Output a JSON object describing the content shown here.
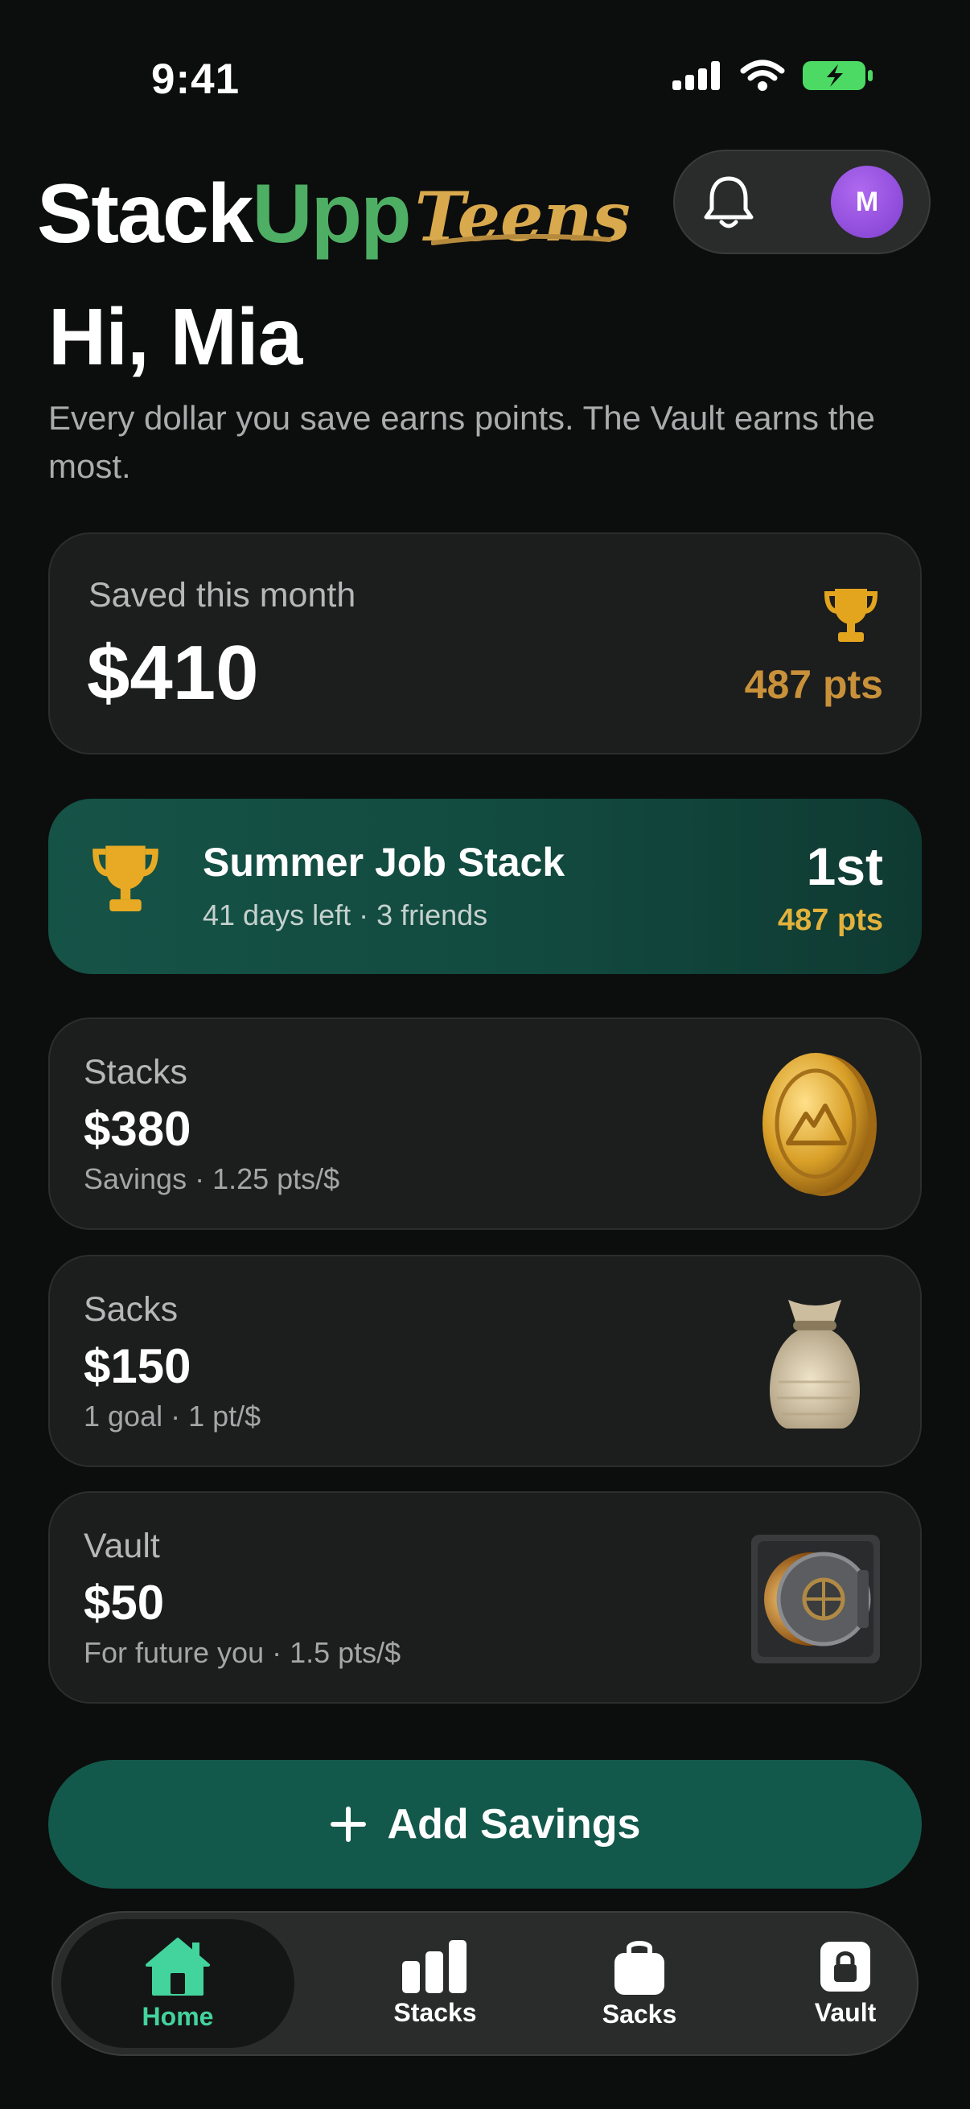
{
  "status_bar": {
    "time": "9:41"
  },
  "header": {
    "logo_stack": "Stack",
    "logo_upp": "Upp",
    "logo_teens": "Teens",
    "avatar_initial": "M"
  },
  "greeting": {
    "title": "Hi, Mia",
    "subtitle": "Every dollar you save earns points. The Vault earns the most."
  },
  "saved_card": {
    "label": "Saved this month",
    "amount": "$410",
    "points": "487 pts"
  },
  "challenge": {
    "title": "Summer Job Stack",
    "subtitle": "41 days left · 3 friends",
    "rank": "1st",
    "points": "487 pts"
  },
  "accounts": [
    {
      "label": "Stacks",
      "amount": "$380",
      "sub": "Savings · 1.25 pts/$",
      "icon": "gold-coin-icon"
    },
    {
      "label": "Sacks",
      "amount": "$150",
      "sub": "1 goal · 1 pt/$",
      "icon": "money-sack-icon"
    },
    {
      "label": "Vault",
      "amount": "$50",
      "sub": "For future you · 1.5 pts/$",
      "icon": "vault-door-icon"
    }
  ],
  "add_button": {
    "label": "Add Savings"
  },
  "tabs": [
    {
      "label": "Home",
      "icon": "home-icon",
      "active": true
    },
    {
      "label": "Stacks",
      "icon": "bar-chart-icon",
      "active": false
    },
    {
      "label": "Sacks",
      "icon": "bag-icon",
      "active": false
    },
    {
      "label": "Vault",
      "icon": "lock-icon",
      "active": false
    }
  ],
  "colors": {
    "background": "#0c0d0d",
    "card": "#1c1d1d",
    "brand_green": "#4eae64",
    "gold": "#d9a94d",
    "teal_button": "#13594b",
    "active_tab": "#43d39c",
    "avatar": "#9b55e6"
  }
}
